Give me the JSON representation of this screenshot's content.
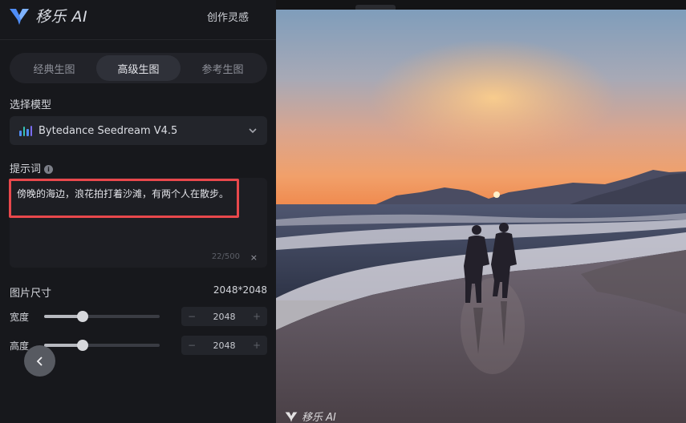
{
  "app": {
    "logo_text": "移乐 AI",
    "nav_inspire": "创作灵感"
  },
  "tabs": [
    {
      "label": "经典生图",
      "active": false
    },
    {
      "label": "高级生图",
      "active": true
    },
    {
      "label": "参考生图",
      "active": false
    }
  ],
  "model": {
    "section_label": "选择模型",
    "selected": "Bytedance Seedream V4.5",
    "icon": "bar-chart-icon"
  },
  "prompt": {
    "section_label": "提示词",
    "value": "傍晚的海边，浪花拍打着沙滩，有两个人在散步。",
    "counter": "22/500",
    "clear_label": "×",
    "highlight_color": "#e9484c"
  },
  "size": {
    "section_label": "图片尺寸",
    "value": "2048*2048",
    "width": {
      "label": "宽度",
      "value": "2048",
      "minus": "−",
      "plus": "+",
      "fraction": 0.33
    },
    "height": {
      "label": "高度",
      "value": "2048",
      "minus": "−",
      "plus": "+",
      "fraction": 0.33
    }
  },
  "preview": {
    "watermark": "移乐 AI",
    "description_icon": "generated-image"
  },
  "colors": {
    "accent": "#e9484c",
    "panel_bg": "#17181c",
    "logo_blue": "#4f8df7"
  }
}
